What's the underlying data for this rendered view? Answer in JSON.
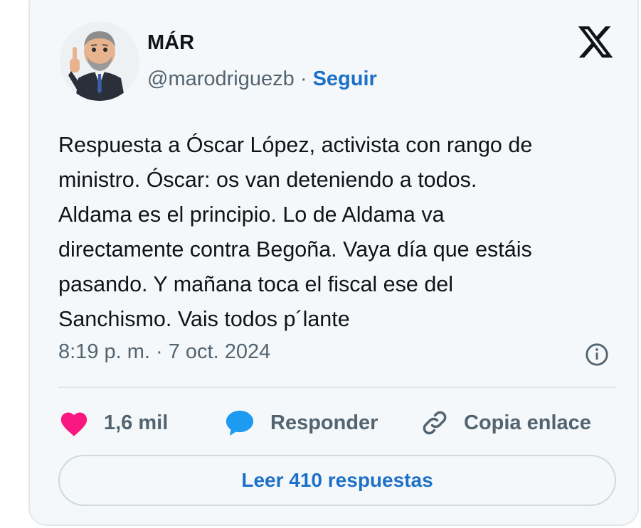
{
  "author": {
    "display_name": "MÁR",
    "handle": "@marodriguezb",
    "separator": "·",
    "follow_label": "Seguir"
  },
  "tweet": {
    "text": "Respuesta a Óscar López, activista con rango de\nministro.  Óscar: os van deteniendo a todos.\nAldama es el principio. Lo de Aldama va\ndirectamente contra Begoña. Vaya día que estáis\npasando. Y mañana toca el fiscal ese del\nSanchismo. Vais todos p´lante",
    "timestamp": "8:19 p. m. · 7 oct. 2024"
  },
  "actions": {
    "likes": "1,6 mil",
    "reply_label": "Responder",
    "copy_label": "Copia enlace"
  },
  "read_replies_label": "Leer 410 respuestas",
  "icons": {
    "platform": "x-logo-icon",
    "info": "info-icon",
    "like": "heart-icon",
    "reply": "speech-bubble-icon",
    "copy": "link-icon"
  },
  "colors": {
    "accent": "#1d70c8",
    "heart": "#f91880",
    "bubble": "#1d9bf0",
    "muted": "#536471",
    "card_bg": "#f5f8fa"
  }
}
